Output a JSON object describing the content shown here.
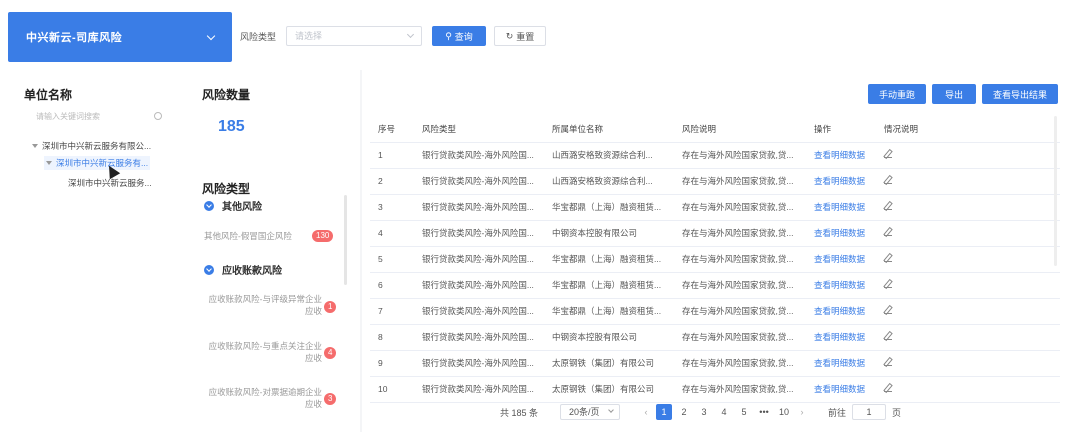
{
  "org": {
    "selected": "中兴新云-司库风险"
  },
  "filter": {
    "label": "风险类型",
    "placeholder": "请选择",
    "search_label": "查询",
    "reset_label": "重置"
  },
  "unit_panel": {
    "title": "单位名称",
    "search_placeholder": "请输入关键词搜索",
    "tree": [
      "深圳市中兴新云服务有限公...",
      "深圳市中兴新云服务有...",
      "深圳市中兴新云服务..."
    ]
  },
  "risk_count": {
    "title": "风险数量",
    "value": "185"
  },
  "risk_types": {
    "title": "风险类型",
    "categories": [
      {
        "name": "其他风险",
        "items": [
          {
            "label": "其他风险-假冒国企风险",
            "count": "130"
          }
        ]
      },
      {
        "name": "应收账款风险",
        "items": [
          {
            "label": "应收账款风险-与评级异常企业应收",
            "count": "1"
          },
          {
            "label": "应收账款风险-与重点关注企业应收",
            "count": "4"
          },
          {
            "label": "应收账款风险-对票据逾期企业应收",
            "count": "3"
          }
        ]
      }
    ]
  },
  "toolbar": {
    "manual_label": "手动重跑",
    "export_label": "导出",
    "view_export_label": "查看导出结果"
  },
  "table": {
    "headers": [
      "序号",
      "风险类型",
      "所属单位名称",
      "风险说明",
      "操作",
      "情况说明"
    ],
    "action_label": "查看明细数据",
    "rows": [
      [
        "1",
        "银行贷款类风险-海外风险国...",
        "山西潞安格致资源综合利...",
        "存在与海外风险国家贷款,贷..."
      ],
      [
        "2",
        "银行贷款类风险-海外风险国...",
        "山西潞安格致资源综合利...",
        "存在与海外风险国家贷款,贷..."
      ],
      [
        "3",
        "银行贷款类风险-海外风险国...",
        "华宝都鼎（上海）融资租赁...",
        "存在与海外风险国家贷款,贷..."
      ],
      [
        "4",
        "银行贷款类风险-海外风险国...",
        "中钢资本控股有限公司",
        "存在与海外风险国家贷款,贷..."
      ],
      [
        "5",
        "银行贷款类风险-海外风险国...",
        "华宝都鼎（上海）融资租赁...",
        "存在与海外风险国家贷款,贷..."
      ],
      [
        "6",
        "银行贷款类风险-海外风险国...",
        "华宝都鼎（上海）融资租赁...",
        "存在与海外风险国家贷款,贷..."
      ],
      [
        "7",
        "银行贷款类风险-海外风险国...",
        "华宝都鼎（上海）融资租赁...",
        "存在与海外风险国家贷款,贷..."
      ],
      [
        "8",
        "银行贷款类风险-海外风险国...",
        "中钢资本控股有限公司",
        "存在与海外风险国家贷款,贷..."
      ],
      [
        "9",
        "银行贷款类风险-海外风险国...",
        "太原钢铁（集团）有限公司",
        "存在与海外风险国家贷款,贷..."
      ],
      [
        "10",
        "银行贷款类风险-海外风险国...",
        "太原钢铁（集团）有限公司",
        "存在与海外风险国家贷款,贷..."
      ]
    ]
  },
  "pagination": {
    "total": "共 185 条",
    "page_size": "20条/页",
    "prev": "‹",
    "next": "›",
    "pages": [
      "1",
      "2",
      "3",
      "4",
      "5",
      "•••",
      "10"
    ],
    "current": "1",
    "goto_label": "前往",
    "goto_value": "1",
    "goto_suffix": "页"
  },
  "colors": {
    "primary": "#3a7de6",
    "badge": "#f56c6c"
  }
}
